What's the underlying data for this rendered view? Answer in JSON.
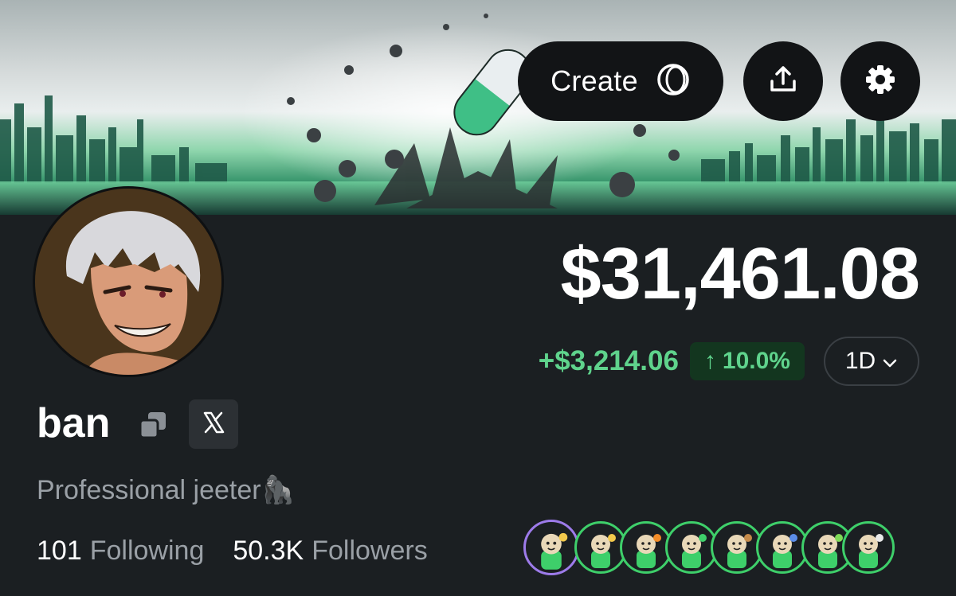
{
  "header": {
    "create_label": "Create",
    "create_icon": "ring-token-icon",
    "share_icon": "share-upload-icon",
    "settings_icon": "gear-icon"
  },
  "profile": {
    "username": "ban",
    "bio": "Professional jeeter",
    "bio_emoji": "🦍",
    "social_icon": "x-logo-icon"
  },
  "portfolio": {
    "balance": "$31,461.08",
    "change_value": "+$3,214.06",
    "change_arrow": "↑",
    "change_percent": "10.0%",
    "period": "1D",
    "accent_color": "#5fd38c"
  },
  "stats": {
    "following_count": "101",
    "following_label": "Following",
    "followers_count": "50.3K",
    "followers_label": "Followers"
  },
  "badges": [
    {
      "name": "crown-badge",
      "ring": "#9d7bea",
      "accent": "#f2c94c"
    },
    {
      "name": "lightning-badge",
      "ring": "#3ecf6a",
      "accent": "#f2c94c"
    },
    {
      "name": "star-eyes-badge",
      "ring": "#3ecf6a",
      "accent": "#f28c28"
    },
    {
      "name": "megaphone-badge",
      "ring": "#3ecf6a",
      "accent": "#3ecf6a"
    },
    {
      "name": "shopper-badge",
      "ring": "#3ecf6a",
      "accent": "#c48a4a"
    },
    {
      "name": "blue-hair-badge",
      "ring": "#3ecf6a",
      "accent": "#5b8de8"
    },
    {
      "name": "wizard-badge",
      "ring": "#3ecf6a",
      "accent": "#7ed957"
    },
    {
      "name": "scholar-badge",
      "ring": "#3ecf6a",
      "accent": "#e8e8e8"
    }
  ]
}
